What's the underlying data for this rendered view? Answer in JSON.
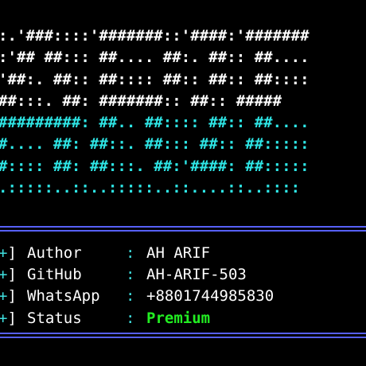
{
  "banner": {
    "lines": [
      ":.'###::::'#######::'####:'#######",
      ":'## ##::: ##.... ##:. ##:: ##....",
      "'##:. ##:: ##:::: ##:: ##:: ##::::",
      "##:::. ##: #######:: ##:: #####",
      "#########: ##.. ##:::: ##:: ##....",
      "#.... ##: ##::. ##::: ##:: ##:::::",
      "#:::: ##: ##:::. ##:'####: ##:::::",
      ".:::::..::..:::::..::....::..::::"
    ],
    "white_color": "#ffffff",
    "cyan_color": "#2ee6e6"
  },
  "info": {
    "rows": [
      {
        "icon": "+",
        "label": "Author   ",
        "sep": ":",
        "value": "AH ARIF"
      },
      {
        "icon": "+",
        "label": "GitHub   ",
        "sep": ":",
        "value": "AH-ARIF-503"
      },
      {
        "icon": "+",
        "label": "WhatsApp ",
        "sep": ":",
        "value": "+8801744985830"
      },
      {
        "icon": "+",
        "label": "Status   ",
        "sep": ":",
        "value": "Premium"
      }
    ],
    "status_color": "#22ee22",
    "separator_color": "#3fe0e0"
  },
  "rules": {
    "color": "#5660ff"
  }
}
